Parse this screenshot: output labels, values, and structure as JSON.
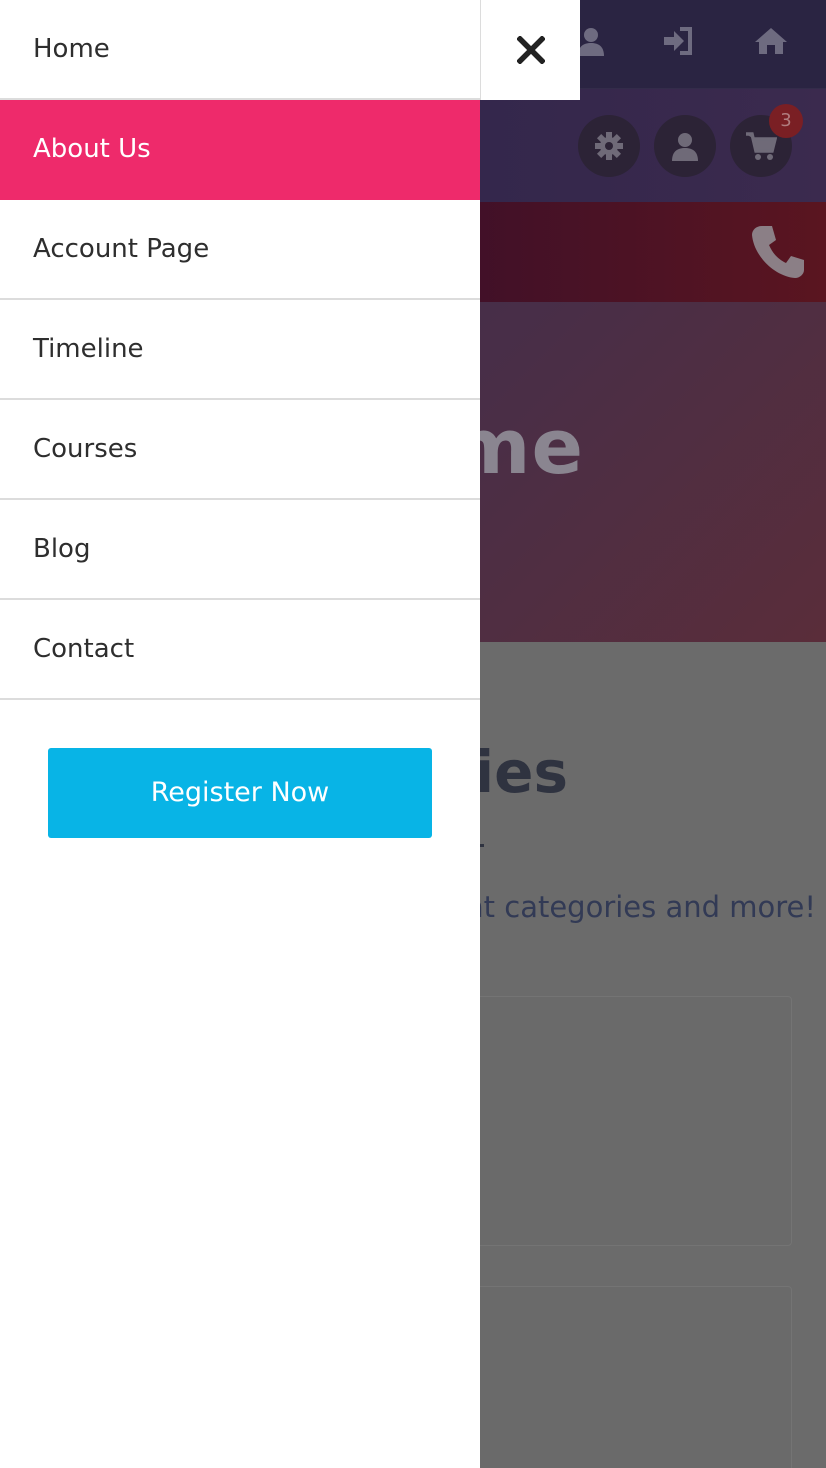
{
  "drawer": {
    "menu": [
      {
        "label": "Home",
        "active": false
      },
      {
        "label": "About Us",
        "active": true
      },
      {
        "label": "Account Page",
        "active": false
      },
      {
        "label": "Timeline",
        "active": false
      },
      {
        "label": "Courses",
        "active": false
      },
      {
        "label": "Blog",
        "active": false
      },
      {
        "label": "Contact",
        "active": false
      }
    ],
    "register_label": "Register Now",
    "close_icon": "close-icon"
  },
  "background": {
    "topbar_icons": [
      "user-icon",
      "sign-in-icon",
      "home-icon"
    ],
    "header_buttons": [
      "gear-icon",
      "user-icon",
      "cart-icon"
    ],
    "cart_count": "3",
    "strip_icon": "phone-icon",
    "hero_title_visible": "me",
    "section_title_visible": "ries",
    "section_subtitle_visible": "nt categories and more!"
  },
  "colors": {
    "active_menu": "#ee2a6b",
    "register_button": "#08b4e6",
    "overlay": "#6b6b6b"
  }
}
